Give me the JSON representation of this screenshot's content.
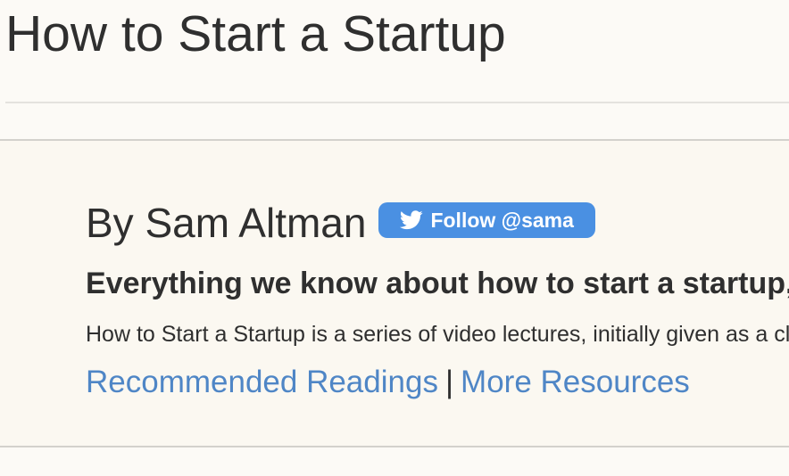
{
  "page": {
    "title": "How to Start a Startup"
  },
  "intro": {
    "author": "By Sam Altman",
    "follow_button_label": "Follow @sama",
    "tagline": "Everything we know about how to start a startup, for free, from some of the world’s experts.",
    "description": "How to Start a Startup is a series of video lectures, initially given as a class at Stanford University.",
    "links": {
      "recommended_readings": "Recommended Readings",
      "separator": "|",
      "more_resources": "More Resources"
    }
  },
  "icons": {
    "follow_button_icon": "twitter-bird-icon"
  },
  "colors": {
    "background": "#fcfaf6",
    "band_background": "#fbf8f1",
    "text": "#2f2f2f",
    "link": "#4f86c6",
    "follow_button": "#4a90e2"
  }
}
